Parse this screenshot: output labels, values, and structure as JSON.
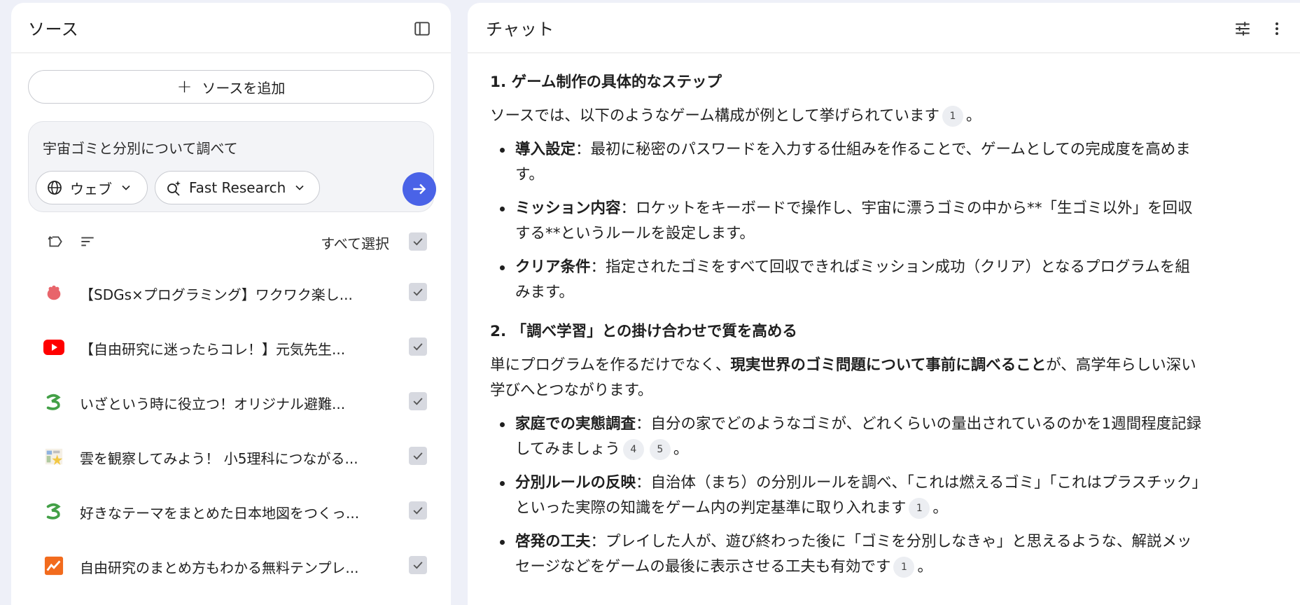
{
  "sources_panel": {
    "title": "ソース",
    "add_source_label": "ソースを追加",
    "research": {
      "query": "宇宙ゴミと分別について調べて",
      "web_label": "ウェブ",
      "mode_label": "Fast Research"
    },
    "select_all_label": "すべて選択",
    "items": [
      {
        "title": "【SDGs×プログラミング】ワクワク楽し...",
        "icon": "web-site-icon"
      },
      {
        "title": "【自由研究に迷ったらコレ！】元気先生...",
        "icon": "youtube-icon"
      },
      {
        "title": "いざという時に役立つ！オリジナル避難...",
        "icon": "site-logo-icon"
      },
      {
        "title": "雲を観察してみよう！ 小5理科につながる...",
        "icon": "site-thumbnail-icon"
      },
      {
        "title": "好きなテーマをまとめた日本地図をつくっ...",
        "icon": "site-logo-icon"
      },
      {
        "title": "自由研究のまとめ方もわかる無料テンプレ...",
        "icon": "chart-logo-icon"
      }
    ]
  },
  "chat_panel": {
    "title": "チャット",
    "section1": {
      "heading": "1. ゲーム制作の具体的なステップ",
      "intro": "ソースでは、以下のようなゲーム構成が例として挙げられています",
      "intro_cite": "1",
      "intro_end": "。",
      "bullets": [
        {
          "term": "導入設定",
          "text": "：最初に秘密のパスワードを入力する仕組みを作ることで、ゲームとしての完成度を高めます。"
        },
        {
          "term": "ミッション内容",
          "text": "：ロケットをキーボードで操作し、宇宙に漂うゴミの中から**「生ゴミ以外」を回収する**というルールを設定します。"
        },
        {
          "term": "クリア条件",
          "text": "：指定されたゴミをすべて回収できればミッション成功（クリア）となるプログラムを組みます。"
        }
      ]
    },
    "section2": {
      "heading": "2. 「調べ学習」との掛け合わせで質を高める",
      "intro_start": "単にプログラムを作るだけでなく、",
      "intro_bold": "現実世界のゴミ問題について事前に調べること",
      "intro_end": "が、高学年らしい深い学びへとつながります。",
      "bullets": [
        {
          "term": "家庭での実態調査",
          "text": "：自分の家でどのようなゴミが、どれくらいの量出されているのかを1週間程度記録してみましょう",
          "cites": [
            "4",
            "5"
          ],
          "end": "。"
        },
        {
          "term": "分別ルールの反映",
          "text": "：自治体（まち）の分別ルールを調べ、「これは燃えるゴミ」「これはプラスチック」といった実際の知識をゲーム内の判定基準に取り入れます",
          "cites": [
            "1"
          ],
          "end": "。"
        },
        {
          "term": "啓発の工夫",
          "text": "：プレイした人が、遊び終わった後に「ゴミを分別しなきゃ」と思えるような、解説メッセージなどをゲームの最後に表示させる工夫も有効です",
          "cites": [
            "1"
          ],
          "end": "。"
        }
      ]
    }
  },
  "colors": {
    "accent": "#4a63e7",
    "background": "#eef0f8",
    "youtube": "#ff0000",
    "site_green": "#4caf50"
  }
}
